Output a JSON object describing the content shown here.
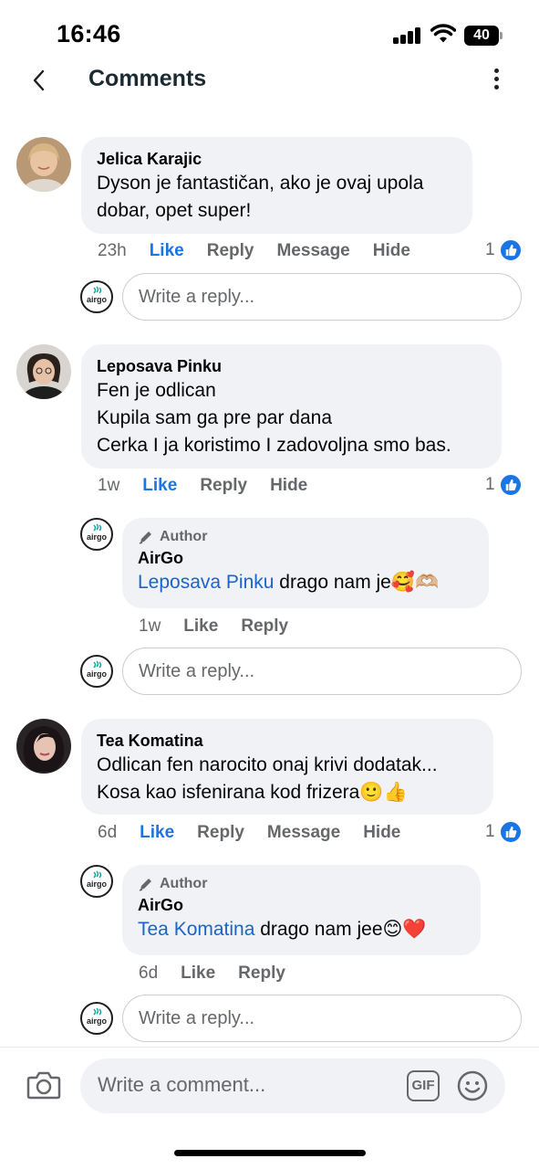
{
  "status_bar": {
    "time": "16:46",
    "battery": "40"
  },
  "header": {
    "title": "Comments"
  },
  "icons": {
    "back": "chevron-left-icon",
    "more": "more-vertical-icon",
    "camera": "camera-icon",
    "emoji": "smiley-icon",
    "like": "thumbs-up-icon",
    "author": "pencil-icon"
  },
  "colors": {
    "link_blue": "#1b74e4",
    "mention_blue": "#1b64c9",
    "bubble_bg": "#f0f2f5",
    "brand_teal": "#19a79b"
  },
  "comments": [
    {
      "author": "Jelica Karajic",
      "text": "Dyson je fantastičan, ako je ovaj upola\ndobar, opet super!",
      "time": "23h",
      "like": "Like",
      "reply": "Reply",
      "message": "Message",
      "hide": "Hide",
      "likes": "1",
      "reply_placeholder": "Write a reply..."
    },
    {
      "author": "Leposava Pinku",
      "text": "Fen je odlican\nKupila sam ga pre par dana\nCerka I ja koristimo I zadovoljna smo bas.",
      "time": "1w",
      "like": "Like",
      "reply": "Reply",
      "hide": "Hide",
      "likes": "1",
      "page_reply": {
        "badge": "Author",
        "author": "AirGo",
        "mention": "Leposava Pinku",
        "text": " drago nam je🥰🫶🏼",
        "time": "1w",
        "like": "Like",
        "reply": "Reply"
      },
      "reply_placeholder": "Write a reply..."
    },
    {
      "author": "Tea Komatina",
      "text": "Odlican fen narocito onaj krivi dodatak...\nKosa kao isfenirana kod frizera🙂👍",
      "time": "6d",
      "like": "Like",
      "reply": "Reply",
      "message": "Message",
      "hide": "Hide",
      "likes": "1",
      "page_reply": {
        "badge": "Author",
        "author": "AirGo",
        "mention": "Tea Komatina",
        "text": " drago nam jee😊❤️",
        "time": "6d",
        "like": "Like",
        "reply": "Reply"
      },
      "reply_placeholder": "Write a reply..."
    }
  ],
  "composer": {
    "placeholder": "Write a comment...",
    "gif": "GIF"
  },
  "brand_logo_text": "airgo"
}
